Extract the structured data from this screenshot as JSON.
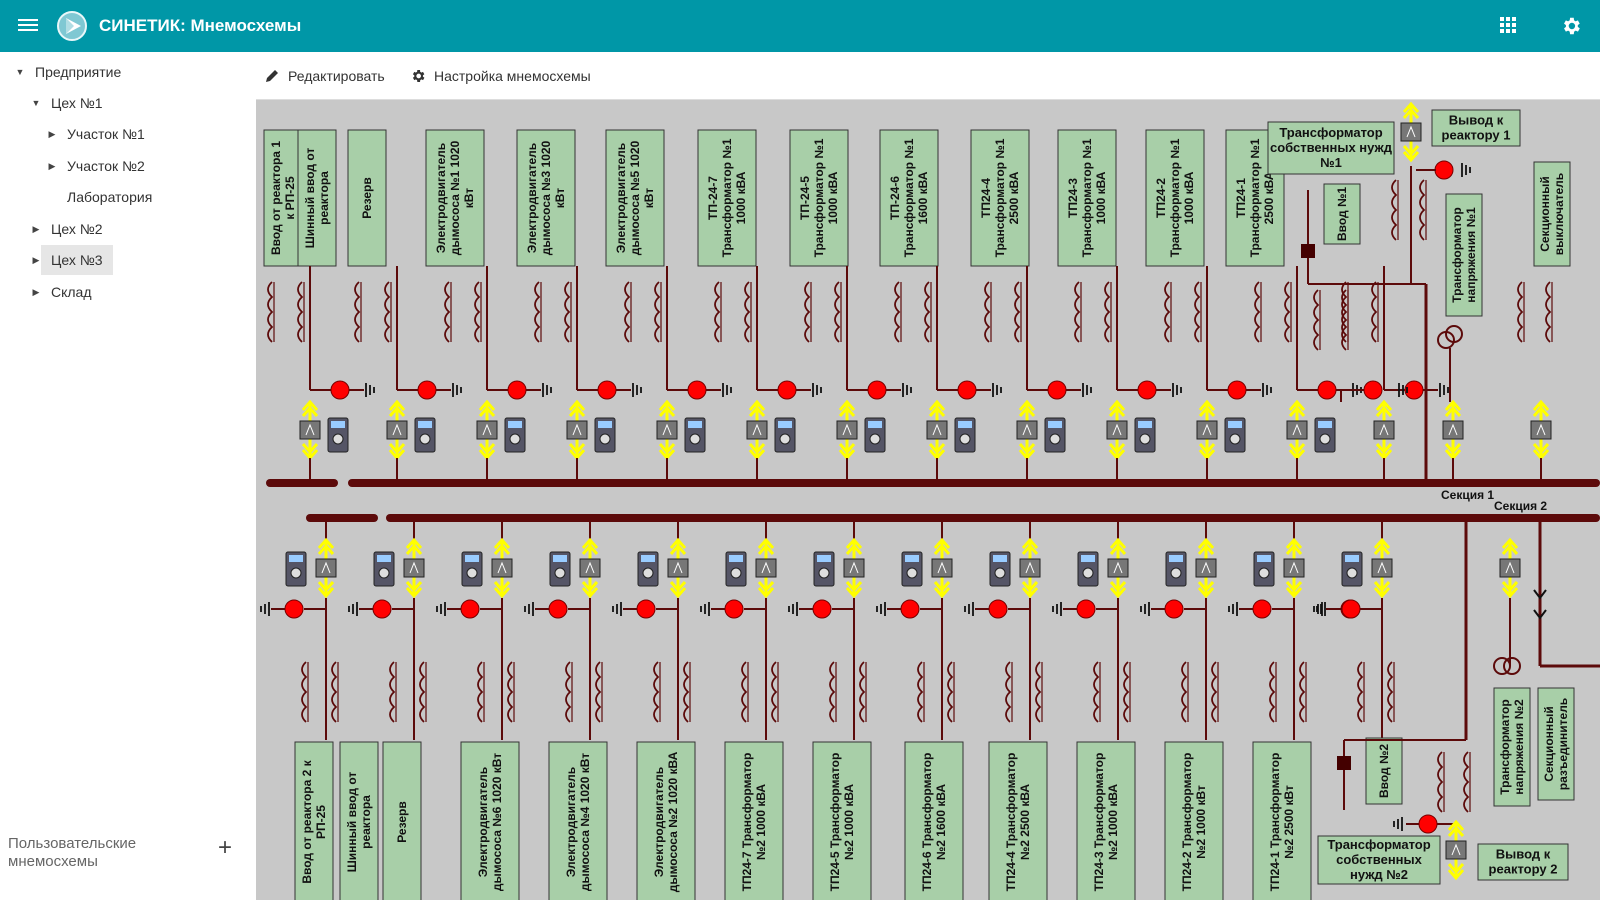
{
  "app": {
    "title": "СИНЕТИК: Мнемосхемы"
  },
  "icons": {
    "menu": "menu-icon",
    "logo": "logo-icon",
    "apps": "apps-grid-icon",
    "settings": "gear-icon",
    "edit": "pencil-icon",
    "setup": "gear-icon",
    "add": "plus-icon"
  },
  "colors": {
    "appbar": "#0097a7",
    "panel_green": "#a8cfa8",
    "bus": "#5c0a0a",
    "breaker": "#ff0000",
    "arrow": "#ffff00",
    "canvas": "#c8c8c8"
  },
  "sidebar": {
    "tree": [
      {
        "label": "Предприятие",
        "expanded": true
      },
      {
        "label": "Цех №1",
        "expanded": true
      },
      {
        "label": "Участок №1"
      },
      {
        "label": "Участок №2"
      },
      {
        "label": "Лаборатория"
      },
      {
        "label": "Цех №2"
      },
      {
        "label": "Цех №3",
        "selected": true
      },
      {
        "label": "Склад"
      }
    ],
    "user_schemes_label": "Пользовательские мнемосхемы",
    "add_label": "+"
  },
  "toolbar": {
    "edit_label": "Редактировать",
    "setup_label": "Настройка мнемосхемы"
  },
  "scheme": {
    "section1_label": "Секция 1",
    "section2_label": "Секция 2",
    "top_panels": [
      "Ввод от реактора 1 к РП-25",
      "Шинный ввод от реактора",
      "Резерв",
      "Электродвигатель дымососа №1 1020 кВт",
      "Электродвигатель дымососа №3 1020 кВт",
      "Электродвигатель дымососа №5 1020 кВт",
      "ТП-24-7 Трансформатор №1 1000 кВА",
      "ТП-24-5 Трансформатор №1 1000 кВА",
      "ТП-24-6 Трансформатор №1 1600 кВА",
      "ТП24-4 Трансформатор №1 2500 кВА",
      "ТП24-3 Трансформатор №1 1000 кВА",
      "ТП24-2 Трансформатор №1 1000 кВА",
      "ТП24-1 Трансформатор №1 2500 кВА"
    ],
    "bottom_panels": [
      "Ввод от реактора 2 к РП-25",
      "Шинный ввод от реактора",
      "Резерв",
      "Электродвигатель дымососа №6 1020 кВт",
      "Электродвигатель дымососа №4 1020 кВт",
      "Электродвигатель дымососа №2 1020 кВА",
      "ТП24-7 Трансформатор №2 1000 кВА",
      "ТП24-5 Трансформатор №2 1000 кВА",
      "ТП24-6 Трансформатор №2 1600 кВА",
      "ТП24-4 Трансформатор №2 2500 кВА",
      "ТП24-3 Трансформатор №2 1000 кВА",
      "ТП24-2 Трансформатор №2 1000 кВт",
      "ТП24-1 Трансформатор №2 2500 кВт"
    ],
    "tsn1": "Трансформатор собственных нужд №1",
    "vvod1": "Ввод №1",
    "out_reactor1": "Вывод к реактору 1",
    "tn1": "Трансформатор напряжения №1",
    "sect_switch": "Секционный выключатель",
    "tsn2": "Трансформатор собственных нужд №2",
    "vvod2": "Ввод №2",
    "out_reactor2": "Вывод к реактору 2",
    "tn2": "Трансформатор напряжения №2",
    "sect_disconnector": "Секционный разъединитель"
  }
}
